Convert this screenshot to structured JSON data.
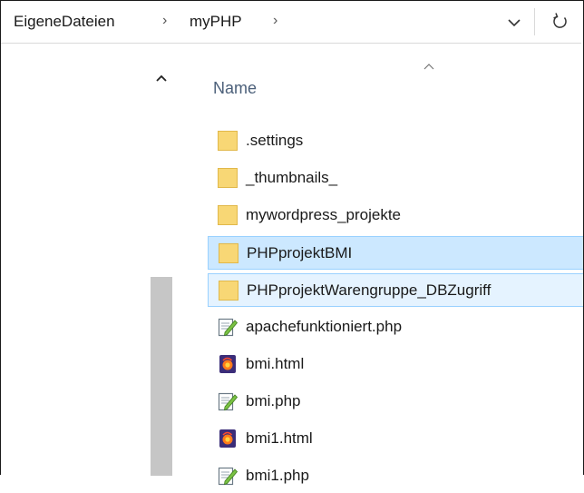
{
  "address_bar": {
    "crumbs": [
      "EigeneDateien",
      "myPHP"
    ],
    "separator": "›"
  },
  "file_list": {
    "column_header": "Name",
    "items": [
      {
        "name": ".settings",
        "type": "folder",
        "state": "normal"
      },
      {
        "name": "_thumbnails_",
        "type": "folder",
        "state": "normal"
      },
      {
        "name": "mywordpress_projekte",
        "type": "folder",
        "state": "normal"
      },
      {
        "name": "PHPprojektBMI",
        "type": "folder",
        "state": "selected"
      },
      {
        "name": "PHPprojektWarengruppe_DBZugriff",
        "type": "folder",
        "state": "hover"
      },
      {
        "name": "apachefunktioniert.php",
        "type": "php",
        "state": "normal"
      },
      {
        "name": "bmi.html",
        "type": "html",
        "state": "normal"
      },
      {
        "name": "bmi.php",
        "type": "php",
        "state": "normal"
      },
      {
        "name": "bmi1.html",
        "type": "html",
        "state": "normal"
      },
      {
        "name": "bmi1.php",
        "type": "php",
        "state": "normal"
      }
    ]
  },
  "colors": {
    "selected_bg": "#cce8ff",
    "selected_border": "#99d1ff",
    "hover_bg": "#e5f3ff",
    "folder": "#f8d775",
    "header_text": "#4c607a"
  }
}
